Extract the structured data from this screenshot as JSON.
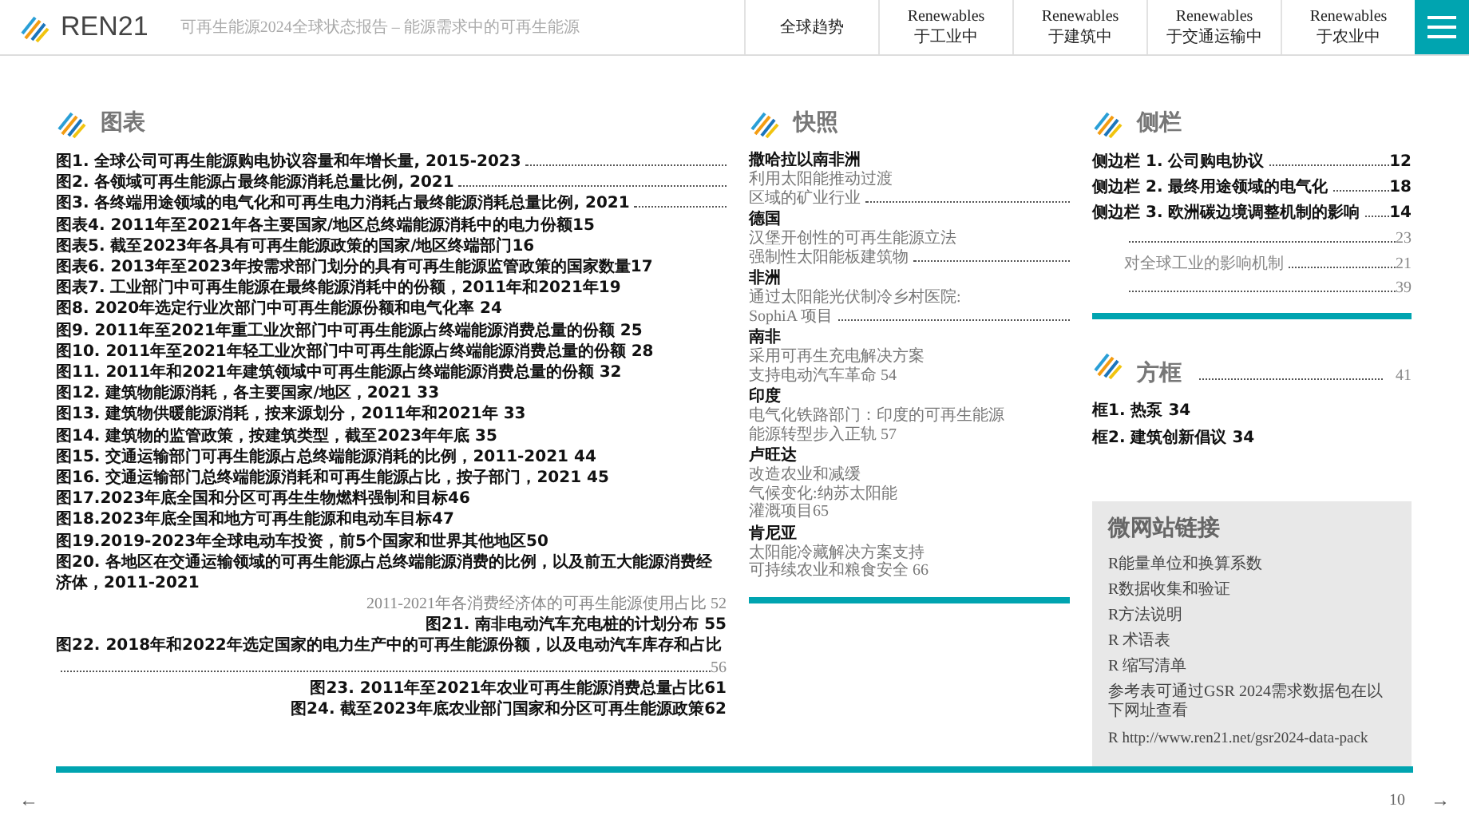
{
  "header": {
    "brand": "REN21",
    "subtitle": "可再生能源2024全球状态报告 – 能源需求中的可再生能源",
    "nav": [
      {
        "label": "全球趋势"
      },
      {
        "label": "Renewables\n于工业中"
      },
      {
        "label": "Renewables\n于建筑中"
      },
      {
        "label": "Renewables\n于交通运输中"
      },
      {
        "label": "Renewables\n于农业中"
      }
    ]
  },
  "figures": {
    "title": "图表",
    "items": [
      {
        "kind": "leader",
        "text": "图1. 全球公司可再生能源购电协议容量和年增长量, 2015-2023"
      },
      {
        "kind": "leader",
        "text": "图2. 各领域可再生能源占最终能源消耗总量比例, 2021"
      },
      {
        "kind": "leader",
        "text": "图3. 各终端用途领域的电气化和可再生电力消耗占最终能源消耗总量比例, 2021"
      },
      {
        "kind": "plain",
        "text": "图表4. 2011年至2021年各主要国家/地区总终端能源消耗中的电力份额15"
      },
      {
        "kind": "plain",
        "text": "图表5. 截至2023年各具有可再生能源政策的国家/地区终端部门16"
      },
      {
        "kind": "plain",
        "text": "图表6. 2013年至2023年按需求部门划分的具有可再生能源监管政策的国家数量17"
      },
      {
        "kind": "plain",
        "text": "图表7. 工业部门中可再生能源在最终能源消耗中的份额，2011年和2021年19"
      },
      {
        "kind": "plain",
        "text": "图8. 2020年选定行业次部门中可再生能源份额和电气化率 24"
      },
      {
        "kind": "plain",
        "text": "图9. 2011年至2021年重工业次部门中可再生能源占终端能源消费总量的份额 25"
      },
      {
        "kind": "plain",
        "text": "图10. 2011年至2021年轻工业次部门中可再生能源占终端能源消费总量的份额 28"
      },
      {
        "kind": "plain",
        "text": "图11. 2011年和2021年建筑领域中可再生能源占终端能源消费总量的份额 32"
      },
      {
        "kind": "plain",
        "text": "图12. 建筑物能源消耗，各主要国家/地区，2021 33"
      },
      {
        "kind": "plain",
        "text": "图13. 建筑物供暖能源消耗，按来源划分，2011年和2021年 33"
      },
      {
        "kind": "plain",
        "text": "图14. 建筑物的监管政策，按建筑类型，截至2023年年底 35"
      },
      {
        "kind": "plain",
        "text": "图15. 交通运输部门可再生能源占总终端能源消耗的比例，2011-2021 44"
      },
      {
        "kind": "plain",
        "text": "图16. 交通运输部门总终端能源消耗和可再生能源占比，按子部门，2021 45"
      },
      {
        "kind": "plain",
        "text": "图17.2023年底全国和分区可再生生物燃料强制和目标46"
      },
      {
        "kind": "plain",
        "text": "图18.2023年底全国和地方可再生能源和电动车目标47"
      },
      {
        "kind": "plain",
        "text": "图19.2019-2023年全球电动车投资，前5个国家和世界其他地区50"
      },
      {
        "kind": "plain",
        "text": "图20. 各地区在交通运输领域的可再生能源占总终端能源消费的比例，以及前五大能源消费经济体，2011-2021"
      },
      {
        "kind": "continuation",
        "text": "2011-2021年各消费经济体的可再生能源使用占比 52"
      },
      {
        "kind": "right",
        "text": "图21. 南非电动汽车充电桩的计划分布 55"
      },
      {
        "kind": "plain",
        "text": "图22. 2018年和2022年选定国家的电力生产中的可再生能源份额，以及电动汽车库存和占比"
      },
      {
        "kind": "page",
        "text": "56"
      },
      {
        "kind": "right",
        "text": "图23. 2011年至2021年农业可再生能源消费总量占比61"
      },
      {
        "kind": "right",
        "text": "图24. 截至2023年底农业部门国家和分区可再生能源政策62"
      }
    ]
  },
  "snapshots": {
    "title": "快照",
    "groups": [
      {
        "region": "撒哈拉以南非洲",
        "lines": [
          {
            "text": "利用太阳能推动过渡",
            "leader": false
          },
          {
            "text": "区域的矿业行业",
            "leader": true
          }
        ]
      },
      {
        "region": "德国",
        "lines": [
          {
            "text": "汉堡开创性的可再生能源立法",
            "leader": false
          },
          {
            "text": "强制性太阳能板建筑物",
            "leader": true
          }
        ]
      },
      {
        "region": "非洲",
        "lines": [
          {
            "text": "通过太阳能光伏制冷乡村医院:",
            "leader": false
          },
          {
            "text": "SophiA 项目",
            "leader": true
          }
        ]
      },
      {
        "region": "南非",
        "lines": [
          {
            "text": "采用可再生充电解决方案",
            "leader": false
          },
          {
            "text": "支持电动汽车革命 54",
            "leader": false
          }
        ]
      },
      {
        "region": "印度",
        "lines": [
          {
            "text": "电气化铁路部门：印度的可再生能源",
            "leader": false
          },
          {
            "text": "能源转型步入正轨 57",
            "leader": false
          }
        ]
      },
      {
        "region": "卢旺达",
        "lines": [
          {
            "text": "改造农业和减缓",
            "leader": false
          },
          {
            "text": "气候变化:纳苏太阳能",
            "leader": false
          },
          {
            "text": "灌溉项目65",
            "leader": false
          }
        ]
      },
      {
        "region": "肯尼亚",
        "lines": [
          {
            "text": "太阳能冷藏解决方案支持",
            "leader": false
          },
          {
            "text": "可持续农业和粮食安全 66",
            "leader": false
          }
        ]
      }
    ]
  },
  "sidebars": {
    "title": "侧栏",
    "items": [
      {
        "text": "侧边栏 1. 公司购电协议",
        "page": "12"
      },
      {
        "text": "侧边栏 2. 最终用途领域的电气化",
        "page": "18"
      },
      {
        "text": "侧边栏 3. 欧洲碳边境调整机制的影响",
        "page": "14"
      }
    ],
    "leaders": [
      {
        "page": "23"
      },
      {
        "text": "对全球工业的影响机制",
        "page": "21"
      },
      {
        "page": "39"
      }
    ]
  },
  "boxes": {
    "title": "方框",
    "page": "41",
    "items": [
      "框1. 热泵 34",
      "框2. 建筑创新倡议 34"
    ]
  },
  "links": {
    "title": "微网站链接",
    "items": [
      "R能量单位和换算系数",
      "R数据收集和验证",
      "R方法说明",
      "R 术语表",
      "R 缩写清单"
    ],
    "note": "参考表可通过GSR 2024需求数据包在以下网址查看",
    "url": "R http://www.ren21.net/gsr2024-data-pack"
  },
  "footer": {
    "prev": "←",
    "page": "10",
    "next": "→"
  }
}
